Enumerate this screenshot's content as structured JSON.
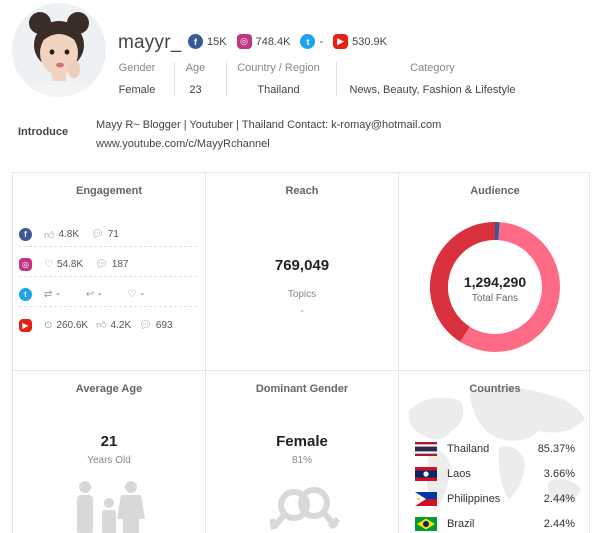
{
  "profile": {
    "username": "mayyr_",
    "gender_label": "Gender",
    "gender": "Female",
    "age_label": "Age",
    "age": "23",
    "region_label": "Country / Region",
    "region": "Thailand",
    "category_label": "Category",
    "category": "News, Beauty, Fashion & Lifestyle",
    "introduce_label": "Introduce",
    "introduce_line1": "Mayy R~ Blogger | Youtuber | Thailand Contact: k-romay@hotmail.com",
    "introduce_line2": "www.youtube.com/c/MayyRchannel"
  },
  "socials": {
    "facebook": "15K",
    "instagram": "748.4K",
    "twitter": "-",
    "youtube": "530.9K"
  },
  "engagement": {
    "title": "Engagement",
    "facebook": {
      "likes": "4.8K",
      "comments": "71"
    },
    "instagram": {
      "likes": "54.8K",
      "comments": "187"
    },
    "twitter": {
      "retweets": "-",
      "replies": "-",
      "likes": "-"
    },
    "youtube": {
      "views": "260.6K",
      "likes": "4.2K",
      "comments": "693"
    }
  },
  "reach": {
    "title": "Reach",
    "value": "769,049",
    "topics_label": "Topics",
    "topics_value": "-"
  },
  "audience": {
    "title": "Audience",
    "total": "1,294,290",
    "total_label": "Total Fans"
  },
  "chart_data": {
    "type": "pie",
    "title": "Audience",
    "categories": [
      "Facebook",
      "Instagram",
      "YouTube"
    ],
    "values": [
      15000,
      748400,
      530900
    ],
    "colors": [
      "#3b5998",
      "#ff6b86",
      "#d8303c"
    ],
    "donut": true
  },
  "average_age": {
    "title": "Average Age",
    "value": "21",
    "unit": "Years Old"
  },
  "dominant_gender": {
    "title": "Dominant Gender",
    "value": "Female",
    "percent": "81%"
  },
  "countries": {
    "title": "Countries",
    "items": [
      {
        "name": "Thailand",
        "percent": "85.37%"
      },
      {
        "name": "Laos",
        "percent": "3.66%"
      },
      {
        "name": "Philippines",
        "percent": "2.44%"
      },
      {
        "name": "Brazil",
        "percent": "2.44%"
      }
    ]
  }
}
